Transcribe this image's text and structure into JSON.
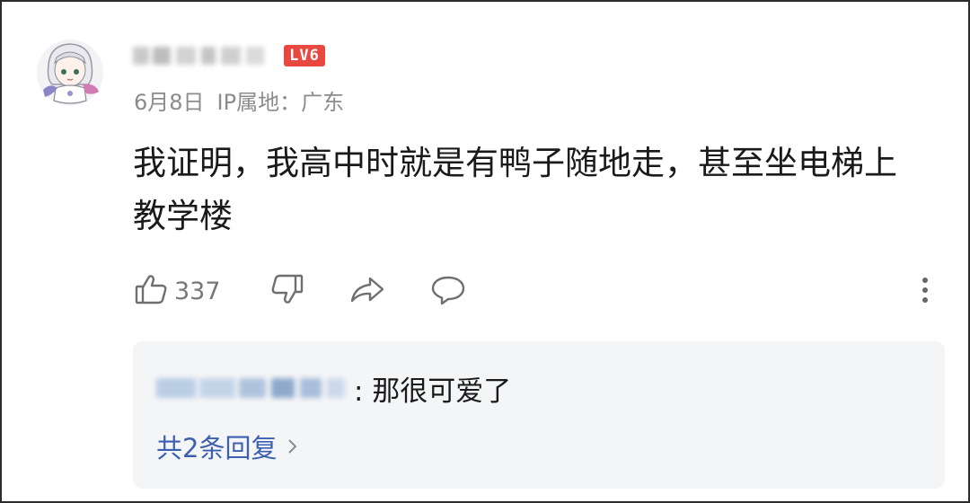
{
  "comment": {
    "level_badge": "LV6",
    "date": "6月8日",
    "ip_location": "IP属地：广东",
    "text": "我证明，我高中时就是有鸭子随地走，甚至坐电梯上教学楼",
    "likes": "337"
  },
  "icons": {
    "like": "thumbs-up-icon",
    "dislike": "thumbs-down-icon",
    "share": "share-arrow-icon",
    "reply": "speech-bubble-icon",
    "more": "more-vertical-icon"
  },
  "reply_thread": {
    "reply_text": ": 那很可爱了",
    "reply_count": "共2条回复"
  },
  "colors": {
    "badge": "#e8483f",
    "link": "#3d5fb0",
    "meta": "#8c8c8c",
    "reply_bg": "#f4f5f7"
  }
}
